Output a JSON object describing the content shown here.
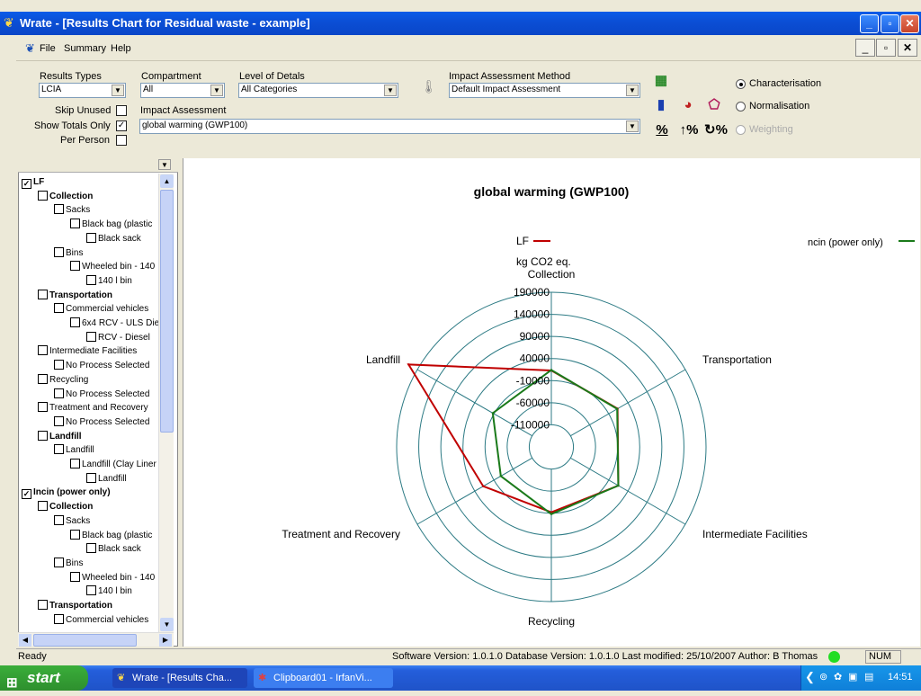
{
  "window": {
    "title": "Wrate - [Results Chart for Residual waste - example]",
    "minimize": "_",
    "maximize": "▫",
    "close": "✕"
  },
  "menu": {
    "items": [
      "File",
      "Summary",
      "Help"
    ]
  },
  "toolbar": {
    "results_types_label": "Results Types",
    "results_types_value": "LCIA",
    "compartment_label": "Compartment",
    "compartment_value": "All",
    "level_label": "Level of Detals",
    "level_value": "All Categories",
    "method_label": "Impact Assessment Method",
    "method_value": "Default Impact Assessment",
    "impact_label": "Impact Assessment",
    "impact_value": "global warming (GWP100)",
    "skip_unused": "Skip Unused",
    "show_totals": "Show Totals Only",
    "per_person": "Per Person",
    "radio_characterisation": "Characterisation",
    "radio_normalisation": "Normalisation",
    "radio_weighting": "Weighting",
    "pct1": "%",
    "pct2": "↑%",
    "pct3": "↻%"
  },
  "tree": [
    {
      "label": "LF",
      "indent": 0,
      "bold": true,
      "checked": true
    },
    {
      "label": "Collection",
      "indent": 1,
      "bold": true
    },
    {
      "label": "Sacks",
      "indent": 2
    },
    {
      "label": "Black bag (plastic",
      "indent": 3
    },
    {
      "label": "Black sack",
      "indent": 4
    },
    {
      "label": "Bins",
      "indent": 2
    },
    {
      "label": "Wheeled bin - 140",
      "indent": 3
    },
    {
      "label": "140 l bin",
      "indent": 4
    },
    {
      "label": "Transportation",
      "indent": 1,
      "bold": true
    },
    {
      "label": "Commercial vehicles",
      "indent": 2
    },
    {
      "label": "6x4 RCV - ULS Die",
      "indent": 3
    },
    {
      "label": "RCV - Diesel",
      "indent": 4
    },
    {
      "label": "Intermediate Facilities",
      "indent": 1
    },
    {
      "label": "No Process Selected",
      "indent": 2
    },
    {
      "label": "Recycling",
      "indent": 1
    },
    {
      "label": "No Process Selected",
      "indent": 2
    },
    {
      "label": "Treatment and Recovery",
      "indent": 1
    },
    {
      "label": "No Process Selected",
      "indent": 2
    },
    {
      "label": "Landfill",
      "indent": 1,
      "bold": true
    },
    {
      "label": "Landfill",
      "indent": 2
    },
    {
      "label": "Landfill (Clay Liner",
      "indent": 3
    },
    {
      "label": "Landfill",
      "indent": 4
    },
    {
      "label": "Incin (power only)",
      "indent": 0,
      "bold": true,
      "checked": true
    },
    {
      "label": "Collection",
      "indent": 1,
      "bold": true
    },
    {
      "label": "Sacks",
      "indent": 2
    },
    {
      "label": "Black bag (plastic",
      "indent": 3
    },
    {
      "label": "Black sack",
      "indent": 4
    },
    {
      "label": "Bins",
      "indent": 2
    },
    {
      "label": "Wheeled bin - 140",
      "indent": 3
    },
    {
      "label": "140 l bin",
      "indent": 4
    },
    {
      "label": "Transportation",
      "indent": 1,
      "bold": true
    },
    {
      "label": "Commercial vehicles",
      "indent": 2
    }
  ],
  "chart_data": {
    "type": "radar",
    "title": "global warming (GWP100)",
    "unit": "kg CO2 eq.",
    "axes": [
      "Collection",
      "Transportation",
      "Intermediate Facilities",
      "Recycling",
      "Treatment and Recovery",
      "Landfill"
    ],
    "ticks": [
      -110000,
      -60000,
      -10000,
      40000,
      90000,
      140000,
      190000
    ],
    "tick_labels": [
      "-110000",
      "-60000",
      "-10000",
      "40000",
      "90000",
      "140000",
      "190000"
    ],
    "rmin": -160000,
    "rmax": 190000,
    "grid": true,
    "series": [
      {
        "name": "LF",
        "color": "#c00000",
        "values": [
          13000,
          13000,
          15000,
          -12000,
          18000,
          213000
        ]
      },
      {
        "name": "Incin (power only)",
        "color": "#1a7a1a",
        "values": [
          14000,
          12000,
          15000,
          -8000,
          -28000,
          -7000
        ]
      }
    ],
    "legend_left": "LF",
    "legend_right": "ncin (power only)"
  },
  "status": {
    "ready": "Ready",
    "version": "Software Version: 1.0.1.0  Database Version: 1.0.1.0  Last modified: 25/10/2007  Author: B Thomas",
    "num": "NUM"
  },
  "taskbar": {
    "start": "start",
    "task1": "Wrate - [Results Cha...",
    "task2": "Clipboard01 - IrfanVi...",
    "clock": "14:51"
  }
}
